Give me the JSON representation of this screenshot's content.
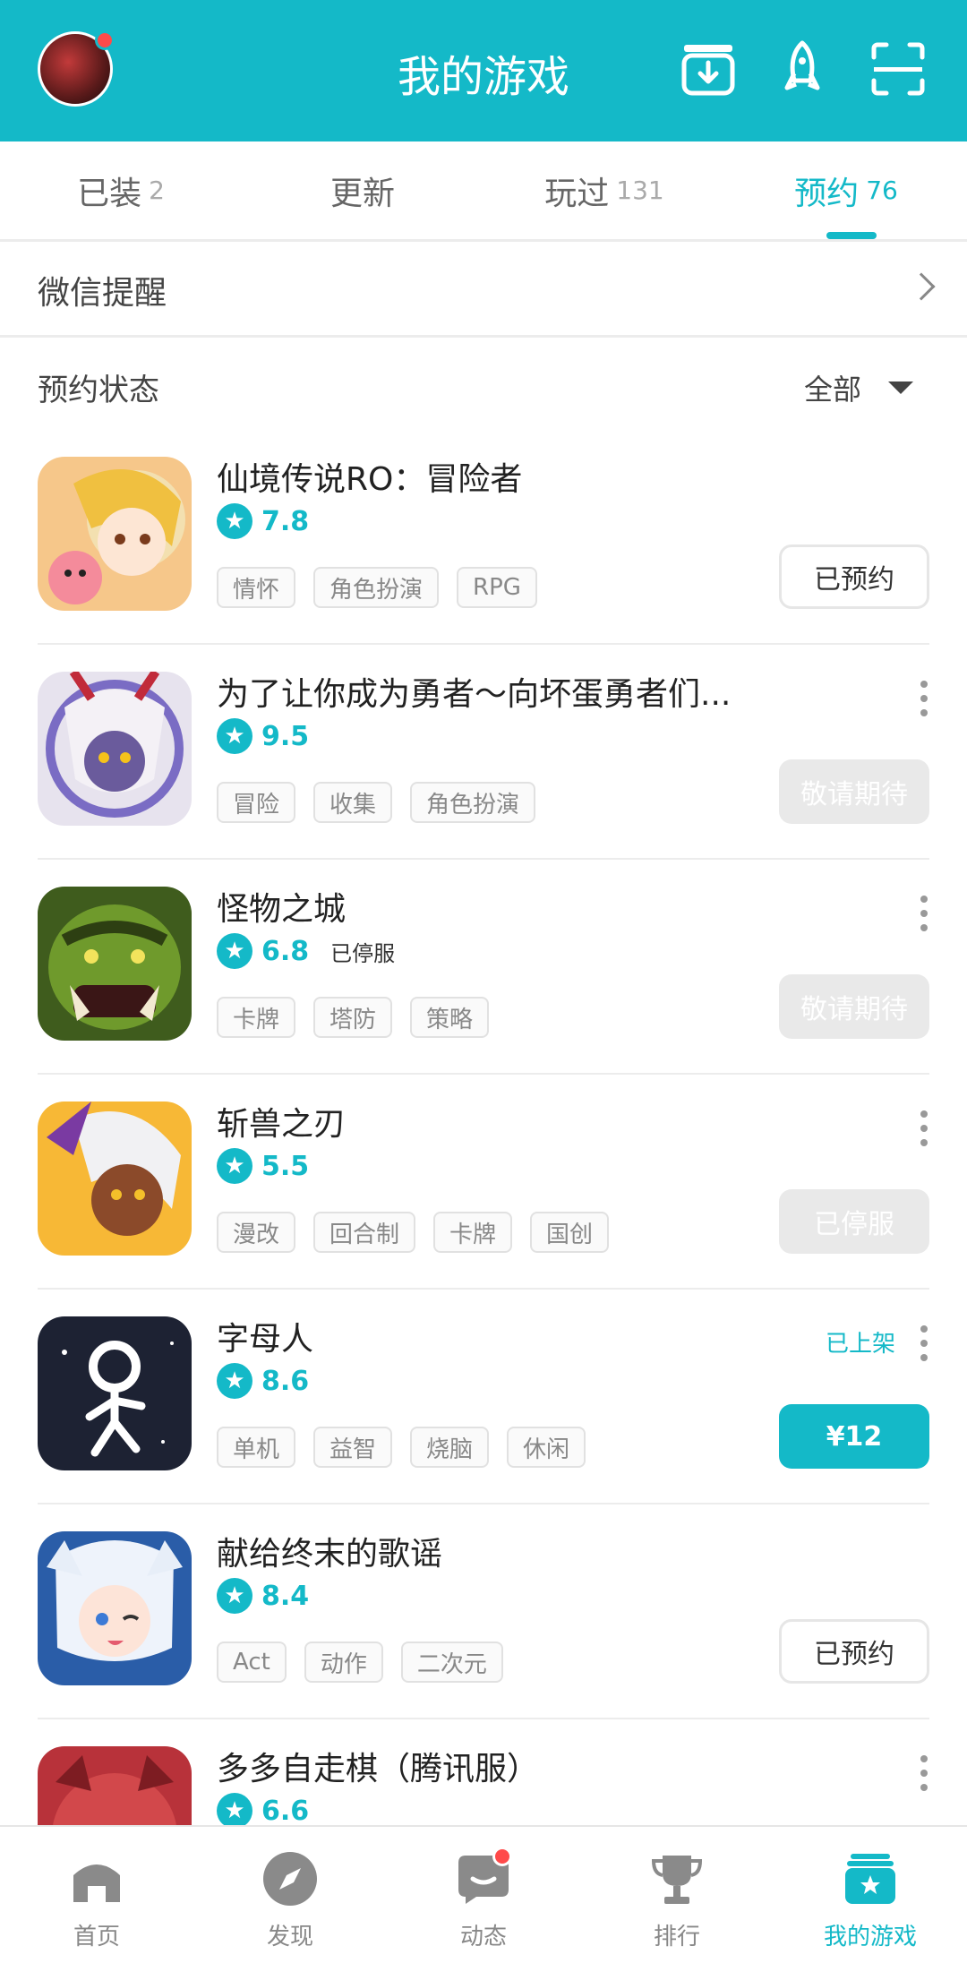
{
  "header": {
    "title": "我的游戏"
  },
  "colors": {
    "accent": "#14b9c8",
    "badge": "#ff4a4a"
  },
  "tabs": [
    {
      "label": "已装",
      "count": "2"
    },
    {
      "label": "更新",
      "count": ""
    },
    {
      "label": "玩过",
      "count": "131"
    },
    {
      "label": "预约",
      "count": "76",
      "active": true
    }
  ],
  "wechat": {
    "label": "微信提醒"
  },
  "filter": {
    "label": "预约状态",
    "selected": "全部"
  },
  "games": [
    {
      "title": "仙境传说RO：冒险者",
      "rating": "7.8",
      "note": "",
      "tags": [
        "情怀",
        "角色扮演",
        "RPG"
      ],
      "button": "已预约",
      "status": ""
    },
    {
      "title": "为了让你成为勇者～向坏蛋勇者们...",
      "rating": "9.5",
      "note": "",
      "tags": [
        "冒险",
        "收集",
        "角色扮演"
      ],
      "button": "敬请期待",
      "status": ""
    },
    {
      "title": "怪物之城",
      "rating": "6.8",
      "note": "已停服",
      "tags": [
        "卡牌",
        "塔防",
        "策略"
      ],
      "button": "敬请期待",
      "status": ""
    },
    {
      "title": "斩兽之刃",
      "rating": "5.5",
      "note": "",
      "tags": [
        "漫改",
        "回合制",
        "卡牌",
        "国创"
      ],
      "button": "已停服",
      "status": ""
    },
    {
      "title": "字母人",
      "rating": "8.6",
      "note": "",
      "tags": [
        "单机",
        "益智",
        "烧脑",
        "休闲"
      ],
      "button": "¥12",
      "status": "已上架"
    },
    {
      "title": "献给终末的歌谣",
      "rating": "8.4",
      "note": "",
      "tags": [
        "Act",
        "动作",
        "二次元"
      ],
      "button": "已预约",
      "status": ""
    },
    {
      "title": "多多自走棋（腾讯服）",
      "rating": "6.6",
      "note": "",
      "tags": [],
      "button": "",
      "status": ""
    }
  ],
  "bottom_nav": [
    {
      "label": "首页",
      "icon": "home-icon"
    },
    {
      "label": "发现",
      "icon": "compass-icon"
    },
    {
      "label": "动态",
      "icon": "chat-icon"
    },
    {
      "label": "排行",
      "icon": "trophy-icon"
    },
    {
      "label": "我的游戏",
      "icon": "my-games-icon"
    }
  ]
}
